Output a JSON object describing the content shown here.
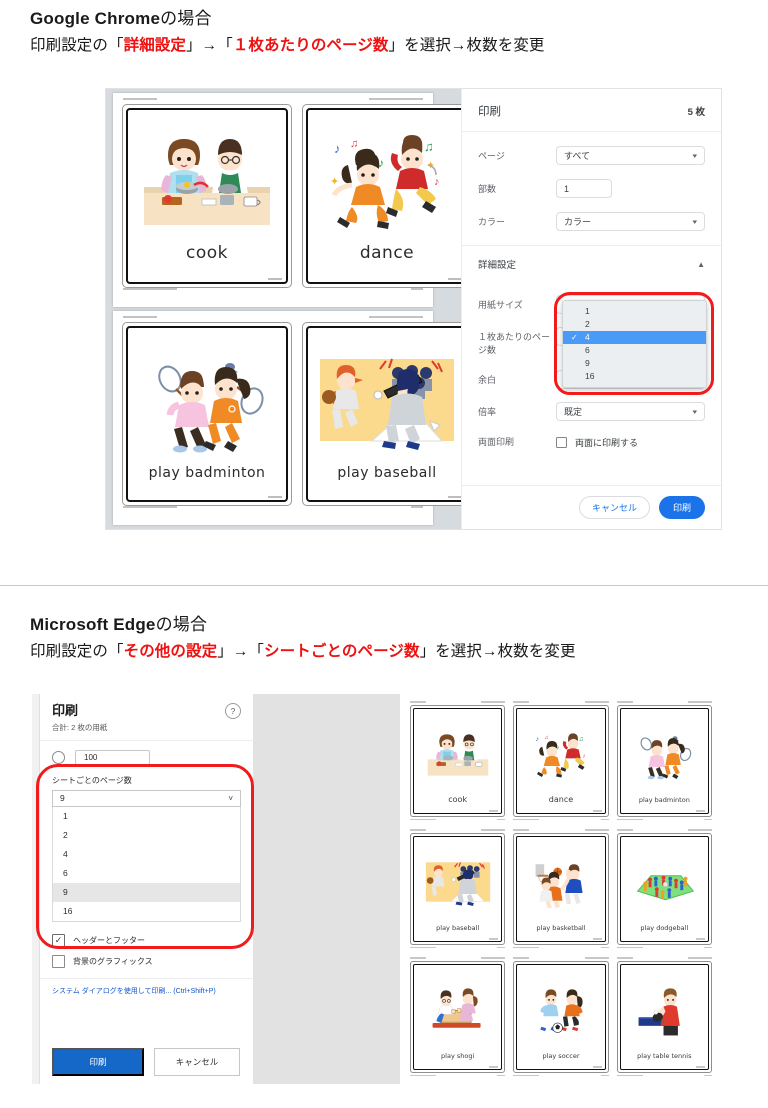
{
  "sections": [
    {
      "id": "chrome",
      "title_bold": "Google Chrome",
      "title_rest": "の場合",
      "sub_parts": {
        "p1": "印刷設定の「",
        "r1": "詳細設定",
        "p2": "」→「",
        "r2": "１枚あたりのページ数",
        "p3": "」を選択→枚数を変更"
      }
    },
    {
      "id": "edge",
      "title_bold": "Microsoft Edge",
      "title_rest": "の場合",
      "sub_parts": {
        "p1": "印刷設定の「",
        "r1": "その他の設定",
        "p2": "」→「",
        "r2": "シートごとのページ数",
        "p3": "」を選択→枚数を変更"
      }
    }
  ],
  "chrome_dialog": {
    "header": {
      "title": "印刷",
      "sheet_count": "5 枚"
    },
    "rows": [
      {
        "label": "ページ",
        "value": "すべて",
        "control": "select"
      },
      {
        "label": "部数",
        "value": "1",
        "control": "textbox"
      },
      {
        "label": "カラー",
        "value": "カラー",
        "control": "select"
      }
    ],
    "advanced_label": "詳細設定",
    "advanced_rows": [
      {
        "label": "用紙サイズ",
        "value": ""
      },
      {
        "label": "１枚あたりのページ数",
        "value": ""
      },
      {
        "label": "余白",
        "value": ""
      },
      {
        "label": "倍率",
        "value": "既定"
      }
    ],
    "duplex": {
      "label": "両面印刷",
      "checkbox_label": "両面に印刷する",
      "checked": false
    },
    "dropdown": {
      "options": [
        "1",
        "2",
        "4",
        "6",
        "9",
        "16"
      ],
      "selected": "4"
    },
    "buttons": {
      "cancel": "キャンセル",
      "print": "印刷"
    }
  },
  "chrome_preview": {
    "pages": [
      {
        "cards": [
          {
            "word": "cook",
            "art": "cook"
          },
          {
            "word": "dance",
            "art": "dance"
          }
        ]
      },
      {
        "cards": [
          {
            "word": "play badminton",
            "art": "badminton"
          },
          {
            "word": "play baseball",
            "art": "baseball"
          }
        ]
      }
    ]
  },
  "edge_dialog": {
    "header": {
      "title": "印刷",
      "subtitle": "合計: 2 枚の用紙",
      "help": "?"
    },
    "scale": {
      "value": "100"
    },
    "pages_per_sheet": {
      "label": "シートごとのページ数",
      "value": "9",
      "options": [
        "1",
        "2",
        "4",
        "6",
        "9",
        "16"
      ],
      "highlighted": "9"
    },
    "checkboxes": [
      {
        "label": "ヘッダーとフッター",
        "checked": true
      },
      {
        "label": "背景のグラフィックス",
        "checked": false
      }
    ],
    "system_dialog_link": "システム ダイアログを使用して印刷... (Ctrl+Shift+P)",
    "buttons": {
      "print": "印刷",
      "cancel": "キャンセル"
    }
  },
  "edge_preview": {
    "cards": [
      {
        "word": "cook",
        "art": "cook"
      },
      {
        "word": "dance",
        "art": "dance"
      },
      {
        "word": "play badminton",
        "art": "badminton"
      },
      {
        "word": "play baseball",
        "art": "baseball"
      },
      {
        "word": "play basketball",
        "art": "basketball"
      },
      {
        "word": "play dodgeball",
        "art": "dodgeball"
      },
      {
        "word": "play shogi",
        "art": "shogi"
      },
      {
        "word": "play soccer",
        "art": "soccer"
      },
      {
        "word": "play table tennis",
        "art": "tabletennis"
      }
    ]
  },
  "colors": {
    "accent_red": "#ee1111",
    "chrome_blue": "#1a73e8",
    "edge_blue": "#1668c8",
    "highlight_blue": "#4a9bf7",
    "preview_bg": "#d6dbe0"
  }
}
